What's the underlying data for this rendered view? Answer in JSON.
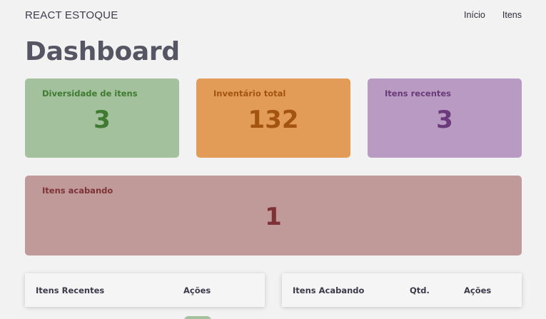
{
  "header": {
    "brand": "REACT ESTOQUE",
    "nav": [
      {
        "label": "Início"
      },
      {
        "label": "Itens"
      }
    ]
  },
  "page": {
    "title": "Dashboard"
  },
  "stats": {
    "diversity": {
      "label": "Diversidade de itens",
      "value": "3"
    },
    "inventory": {
      "label": "Inventário total",
      "value": "132"
    },
    "recent": {
      "label": "Itens recentes",
      "value": "3"
    },
    "ending": {
      "label": "Itens acabando",
      "value": "1"
    }
  },
  "tables": {
    "recent": {
      "headers": [
        "Itens Recentes",
        "Ações"
      ]
    },
    "ending": {
      "headers": [
        "Itens Acabando",
        "Qtd.",
        "Ações"
      ]
    }
  },
  "colors": {
    "diversity_bg": "#a3c19d",
    "inventory_bg": "#e39c58",
    "recent_bg": "#b99ac3",
    "ending_bg": "#c09a99"
  }
}
